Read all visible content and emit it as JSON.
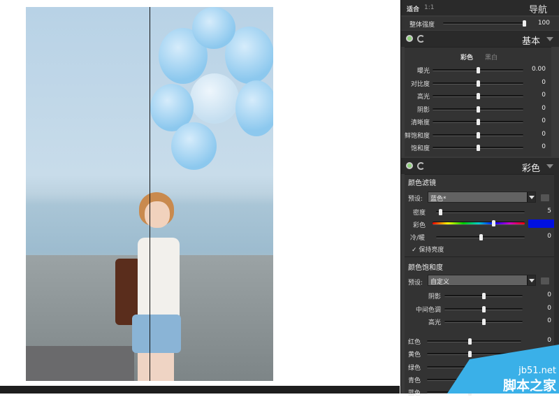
{
  "header": {
    "fit": "适合",
    "one_to_one": "1:1",
    "title": "导航"
  },
  "overall": {
    "label": "整体强度",
    "value": "100",
    "level": 1.0
  },
  "basic": {
    "title": "基本",
    "tabs": [
      "彩色",
      "黑白"
    ],
    "active_tab": "彩色",
    "rows": [
      {
        "label": "曝光",
        "value": "0.00"
      },
      {
        "label": "对比度",
        "value": "0"
      },
      {
        "label": "高光",
        "value": "0"
      },
      {
        "label": "阴影",
        "value": "0"
      },
      {
        "label": "清晰度",
        "value": "0"
      },
      {
        "label": "鲜饱和度",
        "value": "0"
      },
      {
        "label": "饱和度",
        "value": "0"
      }
    ]
  },
  "color": {
    "title": "彩色",
    "filter": {
      "title": "颜色滤镜",
      "preset_label": "预设:",
      "preset_value": "蓝色*",
      "density": {
        "label": "密度",
        "value": "5",
        "level": 0.05
      },
      "hue": {
        "label": "彩色",
        "level": 0.66,
        "swatch": "#0010e0"
      },
      "warm": {
        "label": "冷/暖",
        "value": "0",
        "level": 0.5
      },
      "keep_luminance": {
        "label": "保持亮度",
        "checked": true
      }
    },
    "saturation": {
      "title": "颜色饱和度",
      "preset_label": "预设:",
      "preset_value": "自定义",
      "tones": [
        {
          "label": "阴影",
          "value": "0"
        },
        {
          "label": "中间色调",
          "value": "0"
        },
        {
          "label": "高光",
          "value": "0"
        }
      ],
      "colors": [
        {
          "label": "红色",
          "value": "0"
        },
        {
          "label": "黄色"
        },
        {
          "label": "绿色"
        },
        {
          "label": "青色"
        },
        {
          "label": "蓝色"
        }
      ]
    }
  },
  "watermark": {
    "line1": "jb51.net",
    "line2": "脚本之家"
  }
}
